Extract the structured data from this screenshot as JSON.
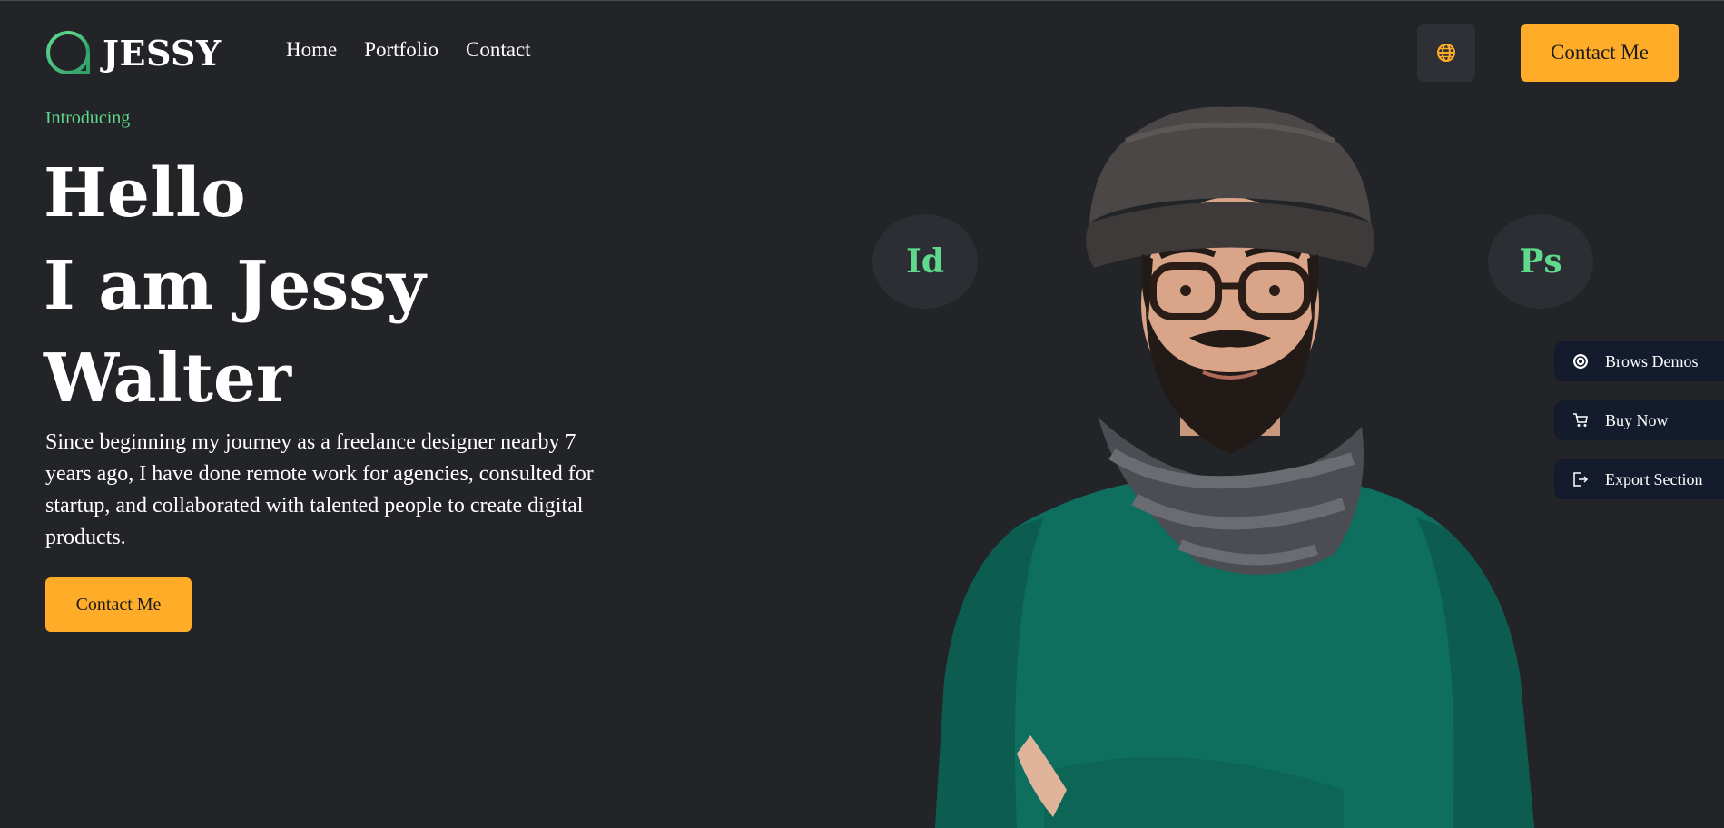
{
  "header": {
    "logo_text": "JESSY",
    "nav": [
      {
        "label": "Home"
      },
      {
        "label": "Portfolio"
      },
      {
        "label": "Contact"
      }
    ],
    "language_icon": "globe-icon",
    "cta_label": "Contact Me"
  },
  "hero": {
    "intro": "Introducing",
    "headline": [
      "Hello",
      "I am Jessy",
      "Walter"
    ],
    "bio": "Since beginning my journey as a freelance designer nearby 7 years ago, I have done remote work for agencies, consulted for startup, and collaborated with talented people to create digital products.",
    "cta_label": "Contact Me"
  },
  "skills": [
    {
      "label": "Id"
    },
    {
      "label": "Ps"
    }
  ],
  "side_actions": [
    {
      "label": "Brows Demos",
      "icon": "demos-icon"
    },
    {
      "label": "Buy Now",
      "icon": "cart-icon"
    },
    {
      "label": "Export Section",
      "icon": "export-icon"
    }
  ],
  "colors": {
    "background": "#232428",
    "accent": "#ffad29",
    "highlight": "#5fd98c",
    "side_button": "#141b2c",
    "sweater": "#0f6f5f"
  }
}
